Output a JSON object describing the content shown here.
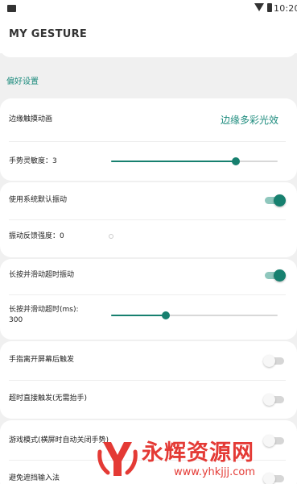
{
  "status_bar": {
    "time": "10:20"
  },
  "app_bar": {
    "title": "MY GESTURE"
  },
  "section": {
    "title": "偏好设置"
  },
  "card1": {
    "edge_animation": {
      "label": "边缘触摸动画",
      "value": "边缘多彩光效"
    },
    "sensitivity": {
      "label": "手势灵敏度：3",
      "level": 0.75
    }
  },
  "card2": {
    "default_vibration": {
      "label": "使用系统默认振动",
      "on": true
    },
    "vibration_strength": {
      "label": "振动反馈强度：0",
      "level": 0,
      "enabled": false
    }
  },
  "card3": {
    "long_press_vibration": {
      "label": "长按并滑动超时振动",
      "on": true
    },
    "long_press_timeout": {
      "label_line1": "长按并滑动超时(ms):",
      "label_line2": "300",
      "level": 0.33
    }
  },
  "card4": {
    "trigger_on_leave": {
      "label": "手指离开屏幕后触发",
      "on": false
    },
    "timeout_trigger": {
      "label": "超时直接触发(无需抬手)",
      "on": false
    }
  },
  "card5": {
    "game_mode": {
      "label": "游戏模式(横屏时自动关闭手势)",
      "on": false
    },
    "avoid_ime": {
      "label": "避免遮挡输入法",
      "on": false
    }
  },
  "watermark": {
    "text": "永辉资源网",
    "url": "www.yhkjjj.com"
  },
  "colors": {
    "accent": "#1e8c7e",
    "switch_on": "#17806f",
    "watermark": "#e43a35",
    "background": "#f0f0f0"
  }
}
